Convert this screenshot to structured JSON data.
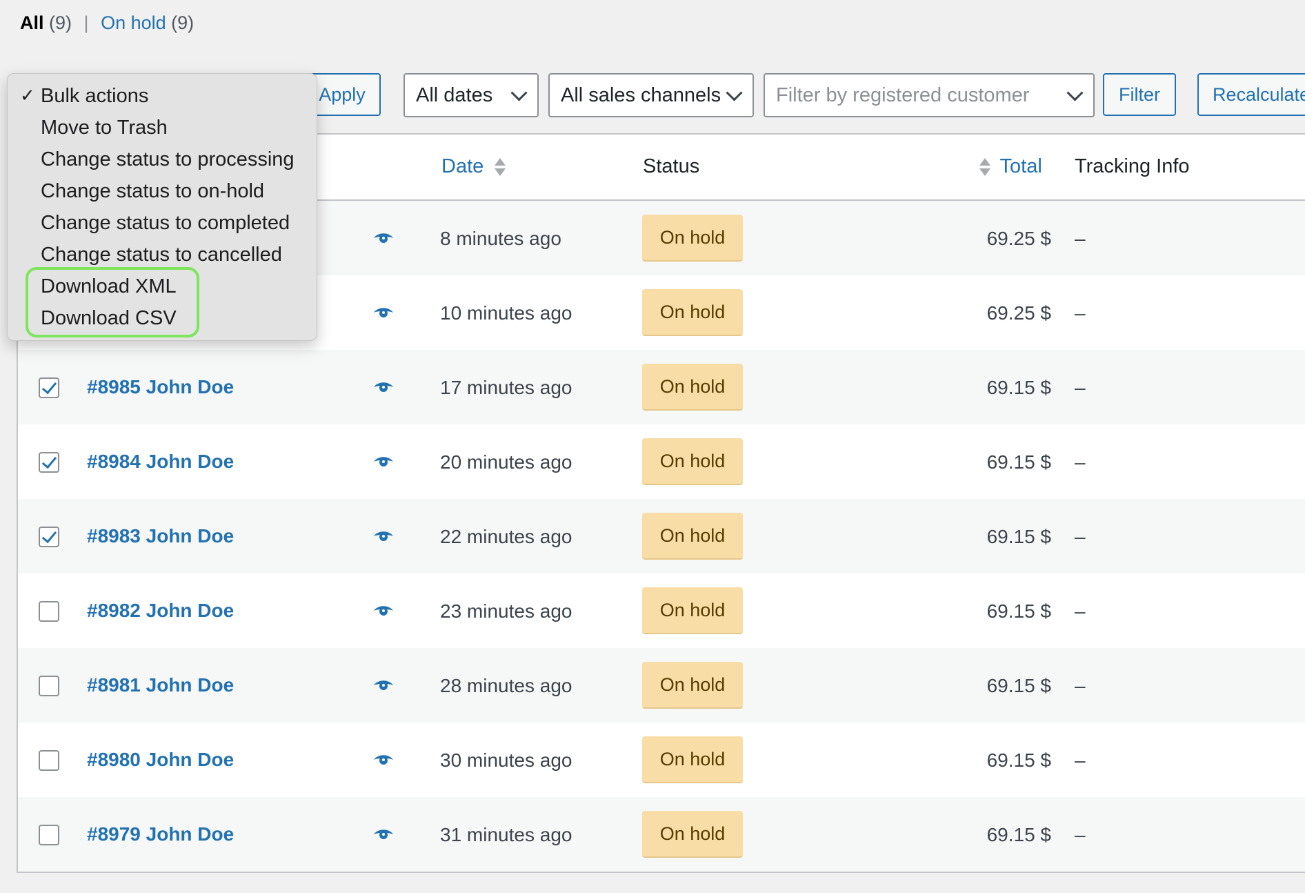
{
  "views": {
    "all_label": "All",
    "all_count": "(9)",
    "separator": "|",
    "onhold_label": "On hold",
    "onhold_count": "(9)"
  },
  "toolbar": {
    "apply_label": "Apply",
    "dates_value": "All dates",
    "channels_value": "All sales channels",
    "customer_placeholder": "Filter by registered customer",
    "filter_label": "Filter",
    "recalculate_label": "Recalculate"
  },
  "bulk_menu": {
    "selected": "Bulk actions",
    "check_glyph": "✓",
    "items": [
      "Bulk actions",
      "Move to Trash",
      "Change status to processing",
      "Change status to on-hold",
      "Change status to completed",
      "Change status to cancelled",
      "Download XML",
      "Download CSV"
    ]
  },
  "table": {
    "headers": {
      "date": "Date",
      "status": "Status",
      "total": "Total",
      "tracking": "Tracking Info"
    },
    "rows": [
      {
        "order": "",
        "checked": false,
        "date": "8 minutes ago",
        "status": "On hold",
        "total": "69.25 $",
        "tracking": "–"
      },
      {
        "order": "",
        "checked": false,
        "date": "10 minutes ago",
        "status": "On hold",
        "total": "69.25 $",
        "tracking": "–"
      },
      {
        "order": "#8985 John Doe",
        "checked": true,
        "date": "17 minutes ago",
        "status": "On hold",
        "total": "69.15 $",
        "tracking": "–"
      },
      {
        "order": "#8984 John Doe",
        "checked": true,
        "date": "20 minutes ago",
        "status": "On hold",
        "total": "69.15 $",
        "tracking": "–"
      },
      {
        "order": "#8983 John Doe",
        "checked": true,
        "date": "22 minutes ago",
        "status": "On hold",
        "total": "69.15 $",
        "tracking": "–"
      },
      {
        "order": "#8982 John Doe",
        "checked": false,
        "date": "23 minutes ago",
        "status": "On hold",
        "total": "69.15 $",
        "tracking": "–"
      },
      {
        "order": "#8981 John Doe",
        "checked": false,
        "date": "28 minutes ago",
        "status": "On hold",
        "total": "69.15 $",
        "tracking": "–"
      },
      {
        "order": "#8980 John Doe",
        "checked": false,
        "date": "30 minutes ago",
        "status": "On hold",
        "total": "69.15 $",
        "tracking": "–"
      },
      {
        "order": "#8979 John Doe",
        "checked": false,
        "date": "31 minutes ago",
        "status": "On hold",
        "total": "69.15 $",
        "tracking": "–"
      }
    ]
  },
  "colors": {
    "link": "#2271b1",
    "status_onhold_bg": "#f8dda7",
    "status_onhold_text": "#573b00",
    "highlight": "#7ee55c",
    "page_bg": "#f0f0f1"
  },
  "icons": {
    "view": "eye-icon",
    "sort": "sort-arrows-icon",
    "select_chevron": "chevron-down-icon",
    "checkmark": "checkmark-icon"
  }
}
